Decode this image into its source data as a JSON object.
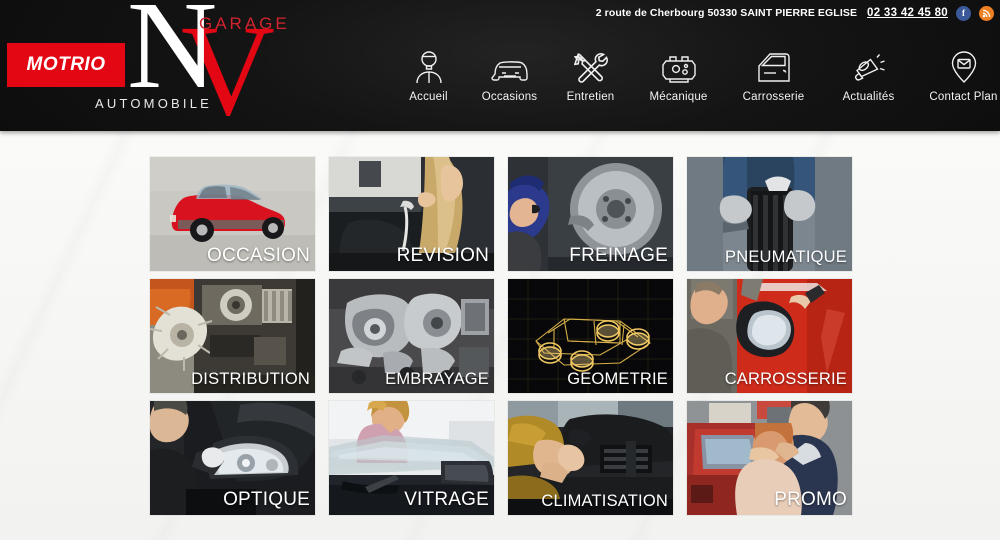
{
  "topbar": {
    "address": "2 route de Cherbourg 50330 SAINT PIERRE EGLISE",
    "phone": "02 33 42 45 80",
    "facebook_label": "f",
    "rss_label": "◔"
  },
  "logo": {
    "motrio": "MOTRIO",
    "letter_n": "N",
    "letter_v": "V",
    "garage": "GARAGE",
    "automobile": "AUTOMOBILE"
  },
  "nav": {
    "items": [
      {
        "label": "Accueil",
        "icon": "mechanic-person-icon"
      },
      {
        "label": "Occasions",
        "icon": "car-front-icon"
      },
      {
        "label": "Entretien",
        "icon": "wrench-screwdriver-icon"
      },
      {
        "label": "Mécanique",
        "icon": "engine-icon"
      },
      {
        "label": "Carrosserie",
        "icon": "car-door-icon"
      },
      {
        "label": "Actualités",
        "icon": "megaphone-icon"
      },
      {
        "label": "Contact  Plan",
        "icon": "map-pin-mail-icon"
      }
    ]
  },
  "tiles": [
    {
      "label": "OCCASION",
      "art": "red-hatchback-car"
    },
    {
      "label": "REVISION",
      "art": "woman-checking-engine"
    },
    {
      "label": "FREINAGE",
      "art": "mechanic-brake-disc"
    },
    {
      "label": "PNEUMATIQUE",
      "art": "hands-holding-tire"
    },
    {
      "label": "DISTRIBUTION",
      "art": "engine-timing-belt"
    },
    {
      "label": "EMBRAYAGE",
      "art": "clutch-parts"
    },
    {
      "label": "GEOMETRIE",
      "art": "wireframe-car-gold"
    },
    {
      "label": "CARROSSERIE",
      "art": "bodywork-red-car"
    },
    {
      "label": "OPTIQUE",
      "art": "headlight-polishing"
    },
    {
      "label": "VITRAGE",
      "art": "windshield-woman"
    },
    {
      "label": "CLIMATISATION",
      "art": "dashboard-air-vents"
    },
    {
      "label": "PROMO",
      "art": "couple-surprise-car"
    }
  ],
  "colors": {
    "brand_red": "#e30613",
    "header_dark": "#141414",
    "page_bg": "#f8f8f6",
    "facebook_blue": "#3b5998",
    "rss_orange": "#ee8022"
  }
}
